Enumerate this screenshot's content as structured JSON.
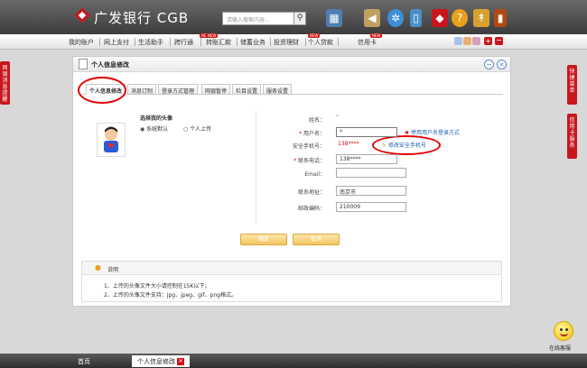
{
  "brand": {
    "name": "广发银行 CGB"
  },
  "search": {
    "placeholder": "请输入搜索内容...",
    "button_icon": "search-icon"
  },
  "nav": {
    "items": [
      {
        "label": "我的账户"
      },
      {
        "label": "网上支付"
      },
      {
        "label": "生活助手"
      },
      {
        "label": "跨行通",
        "badge": "NEW"
      },
      {
        "label": "转账汇款",
        "badge": "NEW"
      },
      {
        "label": "储蓄业务"
      },
      {
        "label": "投资理财"
      },
      {
        "label": "个人贷款",
        "badge": "NEW"
      },
      {
        "label": "信用卡",
        "badge": "NEW"
      }
    ]
  },
  "side_tabs": {
    "left": "网银消息提醒",
    "right_1": "快捷菜单",
    "right_2": "信用卡服务"
  },
  "panel": {
    "title": "个人信息修改",
    "tabs": [
      "个人信息修改",
      "消息订制",
      "登录方式管理",
      "网银暂停",
      "栏目设置",
      "服务设置"
    ]
  },
  "avatar": {
    "heading": "选择我的头像",
    "option_default": "系统默认",
    "option_upload": "个人上传"
  },
  "form": {
    "name_label": "姓名：",
    "name_value": "*",
    "username_label": "用户名：",
    "username_value": "*",
    "disable_username_link": "停用用户名登录方式",
    "phone_label": "安全手机号：",
    "phone_value": "138****",
    "modify_phone_link": "修改安全手机号",
    "contact_label": "联系电话：",
    "contact_value": "138****",
    "email_label": "Email：",
    "email_value": "",
    "address_label": "联系地址：",
    "address_value": "南京市",
    "zip_label": "邮政编码：",
    "zip_value": "210009"
  },
  "buttons": {
    "confirm": "确定",
    "cancel": "取消"
  },
  "notes": {
    "title": "说明",
    "lines": [
      "1、上传的头像文件大小请控制在15K以下；",
      "2、上传的头像文件支持：jpg、jpeg、gif、png格式。"
    ]
  },
  "online_service": "在线客服",
  "taskbar": {
    "home": "首页",
    "active": "个人信息修改"
  },
  "colors": {
    "brand_red": "#c8161d",
    "link_blue": "#1a5fb4",
    "button_gold": "#f3c660"
  }
}
